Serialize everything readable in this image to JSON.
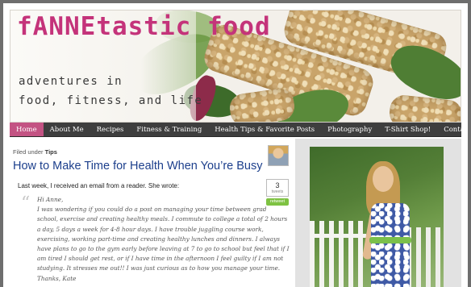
{
  "header": {
    "site_title": "fANNEtastic food",
    "tagline_line1": "adventures in",
    "tagline_line2": "food, fitness, and life"
  },
  "nav": {
    "items": [
      {
        "label": "Home",
        "active": true
      },
      {
        "label": "About Me"
      },
      {
        "label": "Recipes"
      },
      {
        "label": "Fitness & Training"
      },
      {
        "label": "Health Tips & Favorite Posts"
      },
      {
        "label": "Photography"
      },
      {
        "label": "T-Shirt Shop!"
      },
      {
        "label": "Contact Me"
      }
    ],
    "active_color": "#c35383",
    "bar_color": "#3e3e3e"
  },
  "post": {
    "filed_prefix": "Filed under",
    "category": "Tips",
    "title": "How to Make Time for Health When You’re Busy",
    "intro": "Last week, I received an email from a reader. She wrote:",
    "tweets": {
      "count": "3",
      "label": "tweets",
      "retweet_label": "retweet"
    },
    "quote_lines": [
      "Hi Anne,",
      "I was wondering if you could do a post on managing your time between grad",
      "school, exercise and creating healthy meals. I commute to college a total of 2 hours",
      "a day, 5 days a week for 4-8 hour days. I have trouble juggling course work,",
      "exercising, working part-time and creating healthy lunches and dinners. I always",
      "have plans to go to the gym early before leaving at 7 to go to school but feel that if I",
      "am tired I should get rest, or if I have time in the afternoon I feel guilty if I am not",
      "studying. It stresses me out!! I was just curious as to how you manage your time.",
      "Thanks, Kate"
    ],
    "title_color": "#1c3f8c"
  },
  "brand_color": "#c4337a"
}
